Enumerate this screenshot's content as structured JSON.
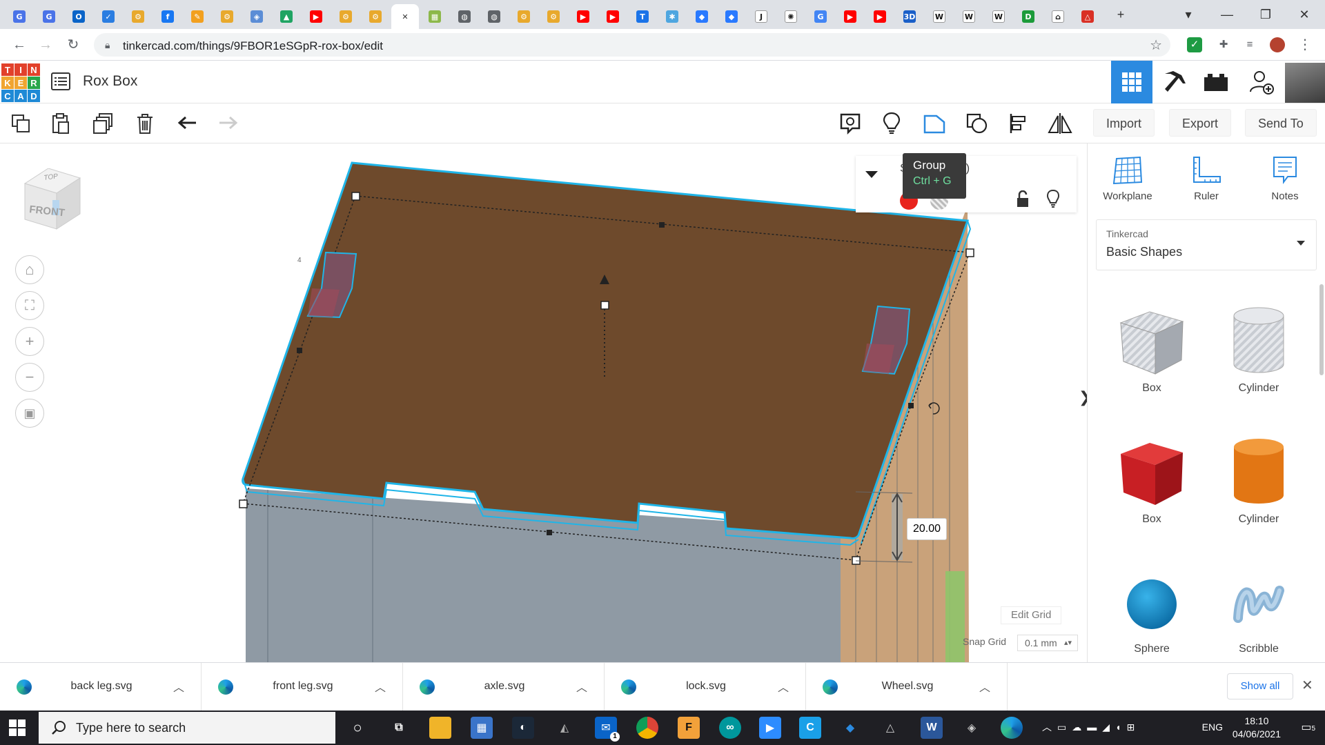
{
  "browser": {
    "tabs": [
      {
        "icon": "google-slides-icon",
        "color": "#4a73e8",
        "glyph": "G"
      },
      {
        "icon": "google-docs-icon",
        "color": "#4a73e8",
        "glyph": "G"
      },
      {
        "icon": "outlook-icon",
        "color": "#0a64c8",
        "glyph": "O"
      },
      {
        "icon": "checkmark-icon",
        "color": "#2a7de1",
        "glyph": "✓"
      },
      {
        "icon": "tinkercad-gear-icon",
        "color": "#e8a92d",
        "glyph": "⚙"
      },
      {
        "icon": "facebook-icon",
        "color": "#1877f2",
        "glyph": "f"
      },
      {
        "icon": "pencil-icon",
        "color": "#f2a01f",
        "glyph": "✎"
      },
      {
        "icon": "tinkercad-gear-icon",
        "color": "#e8a92d",
        "glyph": "⚙"
      },
      {
        "icon": "shield-icon",
        "color": "#5b8dd6",
        "glyph": "◈"
      },
      {
        "icon": "drive-icon",
        "color": "#1fa463",
        "glyph": "▲"
      },
      {
        "icon": "youtube-icon",
        "color": "#ff0000",
        "glyph": "▶"
      },
      {
        "icon": "tinkercad-gear-icon",
        "color": "#e8a92d",
        "glyph": "⚙"
      },
      {
        "icon": "tinkercad-gear-icon",
        "color": "#e8a92d",
        "glyph": "⚙"
      },
      {
        "icon": "close-icon",
        "color": "#ffffff",
        "glyph": "✕"
      },
      {
        "icon": "grid-image-icon",
        "color": "#8cb84a",
        "glyph": "▦"
      },
      {
        "icon": "globe-icon",
        "color": "#5f6368",
        "glyph": "◍"
      },
      {
        "icon": "globe-icon",
        "color": "#5f6368",
        "glyph": "◍"
      },
      {
        "icon": "tinkercad-gear-icon",
        "color": "#e8a92d",
        "glyph": "⚙"
      },
      {
        "icon": "tinkercad-gear-icon",
        "color": "#e8a92d",
        "glyph": "⚙"
      },
      {
        "icon": "youtube-icon",
        "color": "#ff0000",
        "glyph": "▶"
      },
      {
        "icon": "youtube-icon",
        "color": "#ff0000",
        "glyph": "▶"
      },
      {
        "icon": "translate-icon",
        "color": "#1a73e8",
        "glyph": "T"
      },
      {
        "icon": "teams-icon",
        "color": "#4ea6e0",
        "glyph": "✱"
      },
      {
        "icon": "classroom-icon",
        "color": "#2979ff",
        "glyph": "◆"
      },
      {
        "icon": "classroom-icon",
        "color": "#2979ff",
        "glyph": "◆"
      },
      {
        "icon": "jira-icon",
        "color": "#222222",
        "glyph": "J"
      },
      {
        "icon": "brain-icon",
        "color": "#222222",
        "glyph": "✺"
      },
      {
        "icon": "google-icon",
        "color": "#4285f4",
        "glyph": "G"
      },
      {
        "icon": "youtube-icon",
        "color": "#ff0000",
        "glyph": "▶"
      },
      {
        "icon": "youtube-icon",
        "color": "#ff0000",
        "glyph": "▶"
      },
      {
        "icon": "3d-icon",
        "color": "#1a5fc8",
        "glyph": "3D"
      },
      {
        "icon": "wikipedia-icon",
        "color": "#111111",
        "glyph": "W"
      },
      {
        "icon": "wikipedia-icon",
        "color": "#111111",
        "glyph": "W"
      },
      {
        "icon": "wikipedia-icon",
        "color": "#111111",
        "glyph": "W"
      },
      {
        "icon": "edge-reader-icon",
        "color": "#1c9b3a",
        "glyph": "D"
      },
      {
        "icon": "museum-icon",
        "color": "#111111",
        "glyph": "⌂"
      },
      {
        "icon": "warning-icon",
        "color": "#d93025",
        "glyph": "△"
      }
    ],
    "new_tab_glyph": "+",
    "window_controls": {
      "dropdown": "▾",
      "minimize": "—",
      "maximize": "❐",
      "close": "✕"
    },
    "url": "tinkercad.com/things/9FBOR1eSGpR-rox-box/edit"
  },
  "tinkercad": {
    "logo_letters": [
      "T",
      "I",
      "N",
      "K",
      "E",
      "R",
      "C",
      "A",
      "D"
    ],
    "logo_colors": [
      "#e2412b",
      "#e2412b",
      "#e2412b",
      "#f0a530",
      "#f0a530",
      "#27a64b",
      "#1f8ad6",
      "#1f8ad6",
      "#1f8ad6"
    ],
    "design_title": "Rox Box",
    "toolbar_right": {
      "import": "Import",
      "export": "Export",
      "send_to": "Send To"
    },
    "inspector": {
      "title_fragment": "S",
      "title_suffix": "3)"
    },
    "tooltip": {
      "title": "Group",
      "shortcut": "Ctrl + G"
    },
    "viewcube": {
      "top": "TOP",
      "front": "FRONT"
    },
    "dimension_value": "20.00",
    "edit_grid": "Edit Grid",
    "snap_grid_label": "Snap Grid",
    "snap_grid_value": "0.1 mm",
    "panel_tools": [
      {
        "label": "Workplane",
        "icon": "workplane-icon"
      },
      {
        "label": "Ruler",
        "icon": "ruler-icon"
      },
      {
        "label": "Notes",
        "icon": "notes-icon"
      }
    ],
    "library": {
      "provider": "Tinkercad",
      "name": "Basic Shapes"
    },
    "shapes": [
      {
        "label": "Box",
        "kind": "hole-box"
      },
      {
        "label": "Cylinder",
        "kind": "hole-cylinder"
      },
      {
        "label": "Box",
        "kind": "box"
      },
      {
        "label": "Cylinder",
        "kind": "cylinder"
      },
      {
        "label": "Sphere",
        "kind": "sphere"
      },
      {
        "label": "Scribble",
        "kind": "scribble"
      }
    ],
    "colors": {
      "selection": "#1fb5e8",
      "lid": "#6e4a2c",
      "wall": "#8f9aa4",
      "side": "#c9a27a",
      "box_red": "#d42a2a",
      "cylinder_orange": "#e8801a",
      "sphere_blue": "#1591d0",
      "toolbar_active": "#2b8ae0"
    }
  },
  "downloads": {
    "items": [
      {
        "name": "back leg.svg"
      },
      {
        "name": "front leg.svg"
      },
      {
        "name": "axle.svg"
      },
      {
        "name": "lock.svg"
      },
      {
        "name": "Wheel.svg"
      }
    ],
    "show_all": "Show all"
  },
  "taskbar": {
    "search_placeholder": "Type here to search",
    "language": "ENG",
    "time": "18:10",
    "date": "04/06/2021",
    "notification_count": "5",
    "mail_badge": "1"
  }
}
